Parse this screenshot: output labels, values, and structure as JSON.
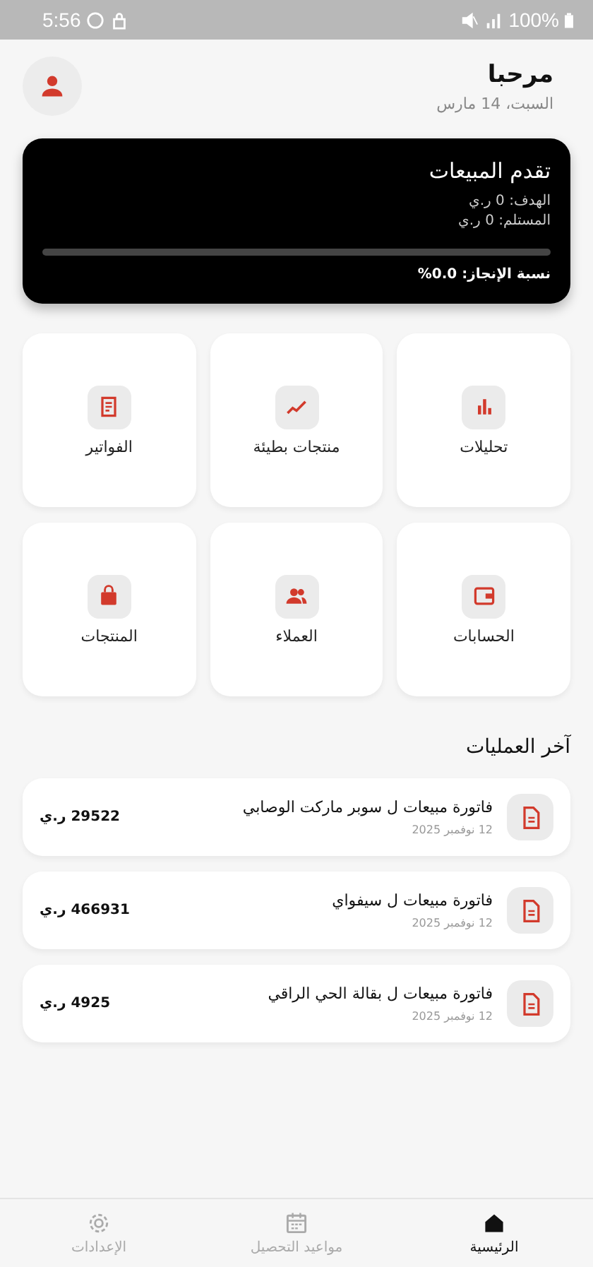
{
  "status_bar": {
    "time": "5:56",
    "battery": "100%"
  },
  "header": {
    "greeting": "مرحبا",
    "date": "السبت، 14 مارس"
  },
  "sales_card": {
    "title": "تقدم المبيعات",
    "target": "الهدف: 0 ر.ي",
    "received": "المستلم: 0 ر.ي",
    "level": 0,
    "completion": "نسبة الإنجاز: 0.0%"
  },
  "tiles": [
    {
      "kind": "analytics",
      "label": "تحليلات"
    },
    {
      "kind": "slow",
      "label": "منتجات بطيئة"
    },
    {
      "kind": "invoices",
      "label": "الفواتير"
    },
    {
      "kind": "accounts",
      "label": "الحسابات"
    },
    {
      "kind": "customers",
      "label": "العملاء"
    },
    {
      "kind": "products",
      "label": "المنتجات"
    }
  ],
  "recent_title": "آخر العمليات",
  "transactions": [
    {
      "title": "فاتورة مبيعات ل سوبر ماركت الوصابي",
      "date": "12 نوفمبر 2025",
      "amount": "29522 ر.ي"
    },
    {
      "title": "فاتورة مبيعات ل سيفواي",
      "date": "12 نوفمبر 2025",
      "amount": "466931 ر.ي"
    },
    {
      "title": "فاتورة مبيعات ل بقالة الحي الراقي",
      "date": "12 نوفمبر 2025",
      "amount": "4925 ر.ي"
    }
  ],
  "nav": [
    {
      "kind": "home",
      "label": "الرئيسية",
      "selected": true
    },
    {
      "kind": "calendar",
      "label": "مواعيد التحصيل",
      "selected": false
    },
    {
      "kind": "settings",
      "label": "الإعدادات",
      "selected": false
    }
  ]
}
